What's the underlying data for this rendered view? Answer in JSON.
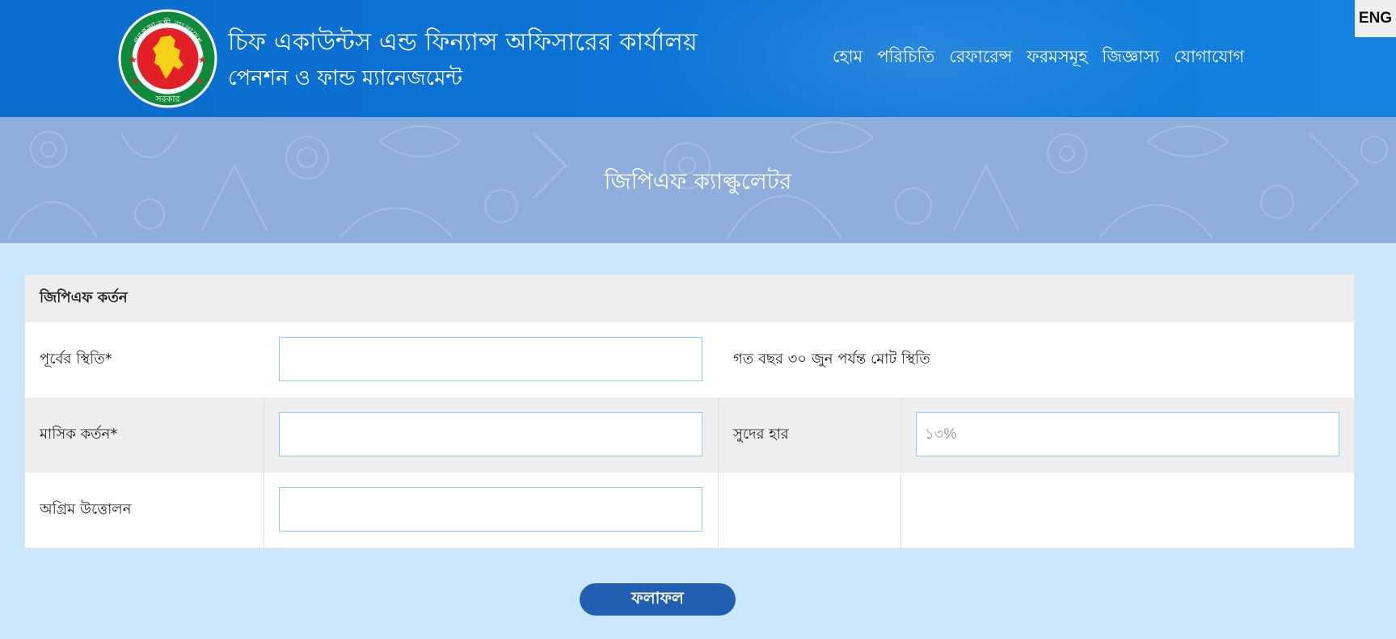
{
  "header": {
    "title_main": "চিফ একাউন্টস এন্ড ফিন্যান্স অফিসারের কার্যালয়",
    "title_sub": "পেনশন ও ফান্ড ম্যানেজমেন্ট",
    "logo_text_top": "গণপ্রজাতন্ত্রী বাংলাদেশ",
    "logo_text_bottom": "সরকার",
    "nav": [
      {
        "label": "হোম"
      },
      {
        "label": "পরিচিতি"
      },
      {
        "label": "রেফারেন্স"
      },
      {
        "label": "ফরমসমূহ"
      },
      {
        "label": "জিজ্ঞাস্য"
      },
      {
        "label": "যোগাযোগ"
      }
    ],
    "lang_button": "ENG"
  },
  "banner": {
    "title": "জিপিএফ ক্যাল্কুলেটর"
  },
  "form": {
    "heading": "জিপিএফ কর্তন",
    "previous_balance": {
      "label": "পূর্বের স্থিতি*",
      "value": "",
      "hint": "গত বছর ৩০ জুন পর্যন্ত মোট স্থিতি"
    },
    "monthly_deduction": {
      "label": "মাসিক কর্তন*",
      "value": ""
    },
    "interest_rate": {
      "label": "সুদের হার",
      "placeholder": "১৩%"
    },
    "advance_withdrawal": {
      "label": "অগ্রিম উত্তোলন",
      "value": ""
    }
  },
  "submit_button": "ফলাফল",
  "colors": {
    "header_blue": "#0c74d6",
    "banner_blue": "#8faedb",
    "page_background": "#cce6fb",
    "button_blue": "#2160b0",
    "input_border": "#8ecbee",
    "logo_green": "#0f8a3c",
    "logo_red": "#e32027"
  }
}
